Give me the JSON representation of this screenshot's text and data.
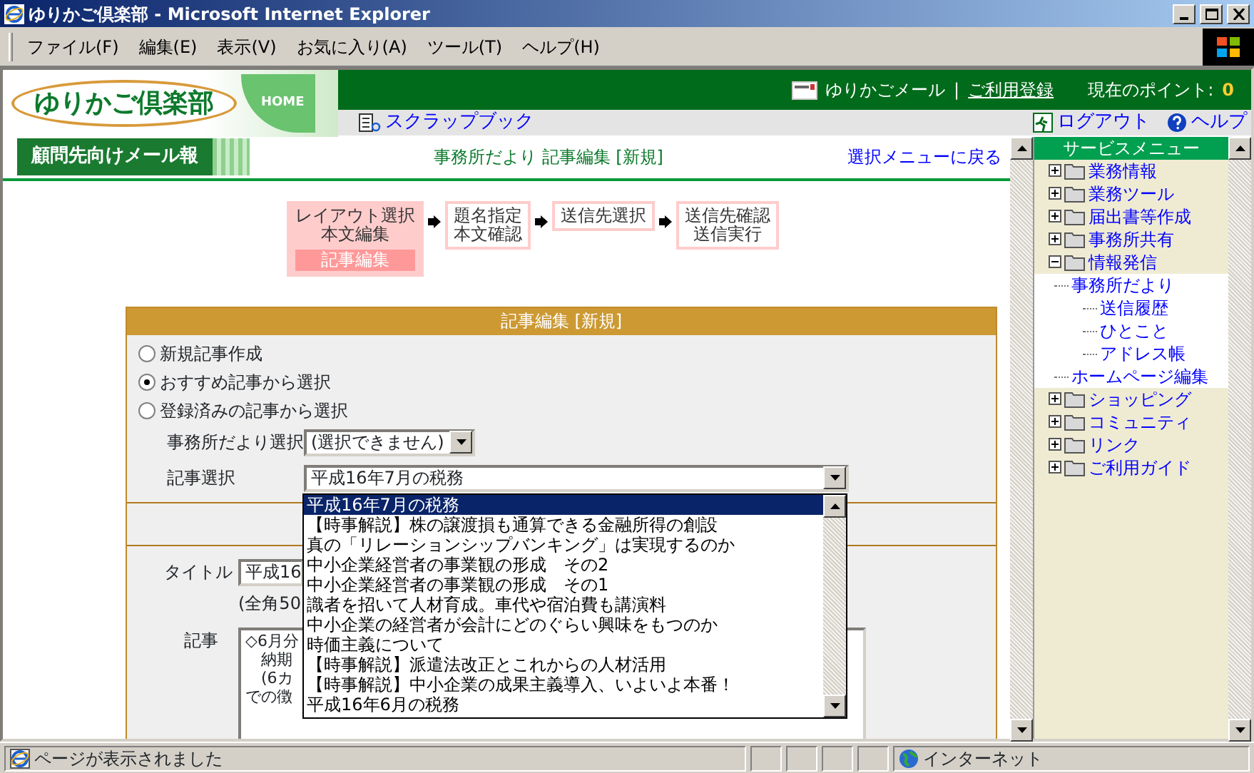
{
  "window": {
    "title": "ゆりかご倶楽部 - Microsoft Internet Explorer"
  },
  "menu_bar": [
    "ファイル(F)",
    "編集(E)",
    "表示(V)",
    "お気に入り(A)",
    "ツール(T)",
    "ヘルプ(H)"
  ],
  "header": {
    "logo": "ゆりかご倶楽部",
    "home": "HOME",
    "mail_link": "ゆりかごメール",
    "separator": "|",
    "register_link": "ご利用登録",
    "points_label": "現在のポイント:",
    "points_value": "0",
    "scrapbook": "スクラップブック",
    "logout": "ログアウト",
    "help": "ヘルプ"
  },
  "content": {
    "section_tag": "顧問先向けメール報",
    "page_title": "事務所だより 記事編集 [新規]",
    "back_link": "選択メニューに戻る",
    "steps": [
      {
        "lines": [
          "レイアウト選択",
          "本文編集"
        ],
        "sub": "記事編集",
        "selected": true
      },
      {
        "lines": [
          "題名指定",
          "本文確認"
        ],
        "selected": false
      },
      {
        "lines": [
          "送信先選択"
        ],
        "selected": false
      },
      {
        "lines": [
          "送信先確認",
          "送信実行"
        ],
        "selected": false
      }
    ],
    "form": {
      "title": "記事編集 [新規]",
      "options": [
        {
          "label": "新規記事作成",
          "selected": false
        },
        {
          "label": "おすすめ記事から選択",
          "selected": true
        },
        {
          "label": "登録済みの記事から選択",
          "selected": false
        }
      ],
      "newsletter_select": {
        "label": "事務所だより選択",
        "value": "(選択できません)"
      },
      "article_select": {
        "label": "記事選択",
        "value": "平成16年7月の税務",
        "expanded": true,
        "options": [
          {
            "label": "平成16年7月の税務",
            "selected": true
          },
          {
            "label": "【時事解説】株の譲渡損も通算できる金融所得の創設",
            "selected": false
          },
          {
            "label": "真の「リレーションシップバンキング」は実現するのか",
            "selected": false
          },
          {
            "label": "中小企業経営者の事業観の形成　その2",
            "selected": false
          },
          {
            "label": "中小企業経営者の事業観の形成　その1",
            "selected": false
          },
          {
            "label": "識者を招いて人材育成。車代や宿泊費も講演料",
            "selected": false
          },
          {
            "label": "中小企業の経営者が会計にどのぐらい興味をもつのか",
            "selected": false
          },
          {
            "label": "時価主義について",
            "selected": false
          },
          {
            "label": "【時事解説】派遣法改正とこれからの人材活用",
            "selected": false
          },
          {
            "label": "【時事解説】中小企業の成果主義導入、いよいよ本番！",
            "selected": false
          },
          {
            "label": "平成16年6月の税務",
            "selected": false
          }
        ]
      },
      "title_field": {
        "label": "タイトル",
        "value": "平成16",
        "note": "(全角50"
      },
      "body_field": {
        "label": "記事",
        "lines": [
          "◇6月分",
          "　納期",
          "　(6カ",
          "での徴"
        ]
      }
    }
  },
  "sidebar": {
    "title": "サービスメニュー",
    "items": [
      {
        "label": "業務情報",
        "expanded": false
      },
      {
        "label": "業務ツール",
        "expanded": false
      },
      {
        "label": "届出書等作成",
        "expanded": false
      },
      {
        "label": "事務所共有",
        "expanded": false
      },
      {
        "label": "情報発信",
        "expanded": true,
        "children": [
          {
            "label": "事務所だより",
            "children": [
              {
                "label": "送信履歴"
              },
              {
                "label": "ひとこと"
              },
              {
                "label": "アドレス帳"
              }
            ]
          },
          {
            "label": "ホームページ編集"
          }
        ]
      },
      {
        "label": "ショッピング",
        "expanded": false
      },
      {
        "label": "コミュニティ",
        "expanded": false
      },
      {
        "label": "リンク",
        "expanded": false
      },
      {
        "label": "ご利用ガイド",
        "expanded": false
      }
    ]
  },
  "status_bar": {
    "text": "ページが表示されました",
    "zone": "インターネット"
  }
}
